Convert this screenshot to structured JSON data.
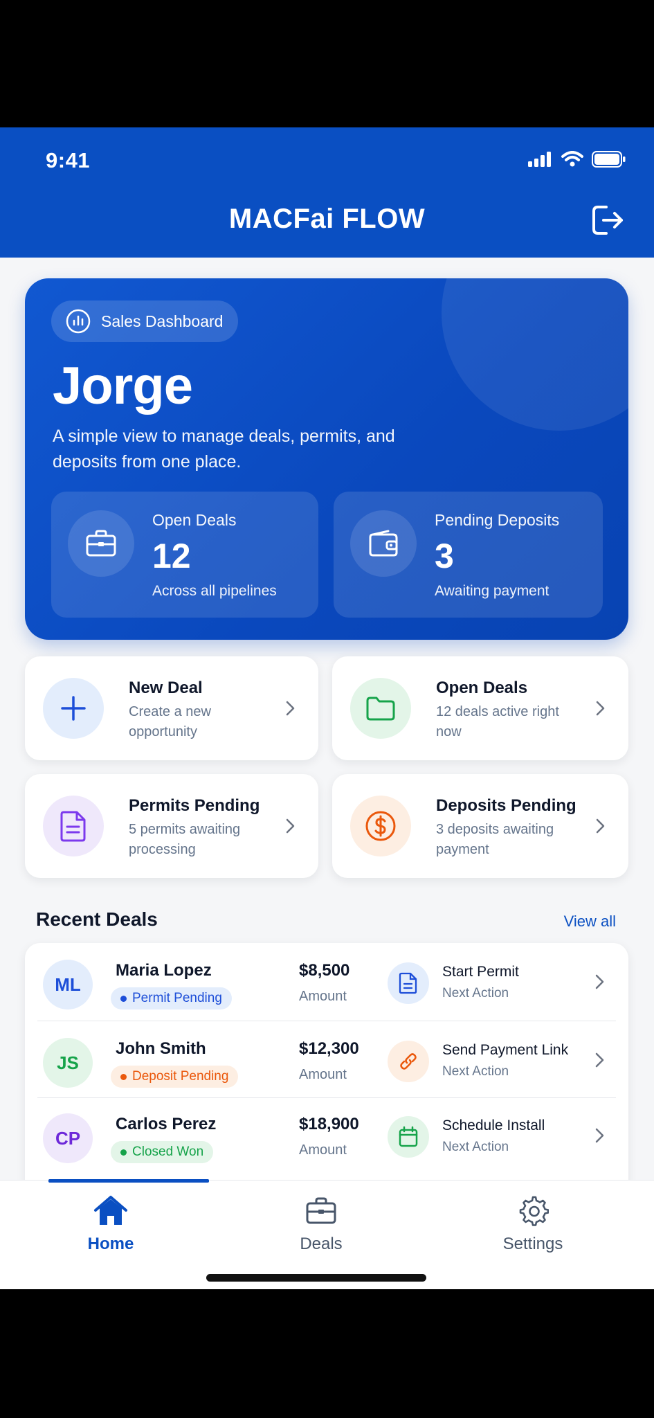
{
  "status_bar": {
    "time": "9:41"
  },
  "header": {
    "title": "MACFai FLOW",
    "logout_icon": "logout-icon"
  },
  "hero": {
    "chip_label": "Sales Dashboard",
    "name": "Jorge",
    "subtitle": "A simple view to manage deals, permits, and deposits from one place.",
    "stats": [
      {
        "label": "Open Deals",
        "value": "12",
        "foot": "Across all pipelines",
        "icon": "briefcase-icon"
      },
      {
        "label": "Pending Deposits",
        "value": "3",
        "foot": "Awaiting payment",
        "icon": "wallet-icon"
      }
    ]
  },
  "actions": [
    {
      "title": "New Deal",
      "desc": "Create a new opportunity",
      "icon": "plus-icon",
      "color": "#2563eb"
    },
    {
      "title": "Open Deals",
      "desc": "12 deals active right now",
      "icon": "folder-icon",
      "color": "#16a34a"
    },
    {
      "title": "Permits Pending",
      "desc": "5 permits awaiting processing",
      "icon": "document-icon",
      "color": "#7c3aed"
    },
    {
      "title": "Deposits Pending",
      "desc": "3 deposits awaiting payment",
      "icon": "dollar-icon",
      "color": "#ea580c"
    }
  ],
  "recent_deals": {
    "title": "Recent Deals",
    "view_all": "View all",
    "rows": [
      {
        "initials": "ML",
        "name": "Maria Lopez",
        "status": "Permit Pending",
        "amount": "$8,500",
        "amount_label": "Amount",
        "next_action": "Start Permit",
        "next_label": "Next Action",
        "next_icon": "document-icon",
        "status_color": "#1d4ed8"
      },
      {
        "initials": "JS",
        "name": "John Smith",
        "status": "Deposit Pending",
        "amount": "$12,300",
        "amount_label": "Amount",
        "next_action": "Send Payment Link",
        "next_label": "Next Action",
        "next_icon": "link-icon",
        "status_color": "#ea580c"
      },
      {
        "initials": "CP",
        "name": "Carlos Perez",
        "status": "Closed Won",
        "amount": "$18,900",
        "amount_label": "Amount",
        "next_action": "Schedule Install",
        "next_label": "Next Action",
        "next_icon": "calendar-icon",
        "status_color": "#16a34a"
      }
    ]
  },
  "bottom_nav": {
    "items": [
      {
        "label": "Home",
        "icon": "home-icon",
        "active": true
      },
      {
        "label": "Deals",
        "icon": "briefcase-icon",
        "active": false
      },
      {
        "label": "Settings",
        "icon": "gear-icon",
        "active": false
      }
    ]
  },
  "colors": {
    "brand": "#0a4fc2",
    "background": "#f5f6f8"
  }
}
